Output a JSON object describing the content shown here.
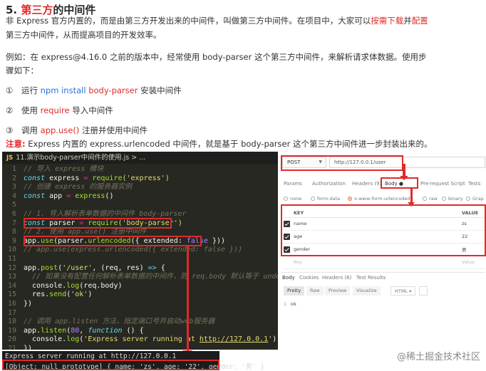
{
  "heading": {
    "number": "5.",
    "title_red": "第三方",
    "title_rest": "的中间件"
  },
  "intro": {
    "line1_a": "非 Express 官方内置的，而是由第三方开发出来的中间件，叫做第三方中间件。在项目中，大家可以",
    "line1_red1": "按需下载",
    "line1_b": "并",
    "line1_red2": "配置",
    "line2": "第三方中间件，从而提高项目的开发效率。"
  },
  "example": {
    "line1": "例如：在 express@4.16.0 之前的版本中，经常使用 body-parser 这个第三方中间件，来解析请求体数据。使用步",
    "line2": "骤如下："
  },
  "steps": [
    {
      "num": "①",
      "text_a": "运行 ",
      "code1": "npm install",
      "text_b": " ",
      "code2": "body-parser",
      "text_c": " 安装中间件"
    },
    {
      "num": "②",
      "text_a": "使用 ",
      "code1": "require",
      "text_b": " 导入中间件"
    },
    {
      "num": "③",
      "text_a": "调用 ",
      "code1": "app.use()",
      "text_b": " 注册并使用中间件"
    }
  ],
  "note": {
    "label": "注意:",
    "text": " Express 内置的 express.urlencoded 中间件，就是基于 body-parser 这个第三方中间件进一步封装出来的。"
  },
  "editor": {
    "file_icon": "JS",
    "breadcrumb": "11.演示body-parser中间件的使用.js > ...",
    "lines": {
      "n1": "1",
      "l1": "// 导入 express 模块",
      "n2": "2",
      "l2_kw": "const",
      "l2_var": " express ",
      "l2_op": "=",
      "l2_fn": " require",
      "l2_str": "('express')",
      "n3": "3",
      "l3": "// 创建 express 的服务器实例",
      "n4": "4",
      "l4_kw": "const",
      "l4_var": " app ",
      "l4_op": "=",
      "l4_fn": " express",
      "l4_rest": "()",
      "n5": "5",
      "n6": "6",
      "l6": "// 1. 导入解析表单数据的中间件 body-parser",
      "n7": "7",
      "l7_kw": "const",
      "l7_var": " parser ",
      "l7_op": "=",
      "l7_fn": " require",
      "l7_str": "('body-parser')",
      "n8": "8",
      "l8": "// 2. 使用 app.use() 注册中间件",
      "n9": "9",
      "l9_a": "app.",
      "l9_fn": "use",
      "l9_b": "(parser.",
      "l9_fn2": "urlencoded",
      "l9_c": "({ ",
      "l9_key": "extended:",
      "l9_val": " false",
      "l9_d": " }))",
      "n10": "10",
      "l10": "// app.use(express.urlencoded({ extended: false }))",
      "n11": "11",
      "n12": "12",
      "l12_a": "app.",
      "l12_fn": "post",
      "l12_b": "(",
      "l12_str": "'/user'",
      "l12_c": ", (req, res) ",
      "l12_op": "=>",
      "l12_d": " {",
      "n13": "13",
      "l13": "  // 如果没有配置任何解析表单数据的中间件，则 req.body 默认等于 undefined",
      "n14": "14",
      "l14_a": "  console.",
      "l14_fn": "log",
      "l14_b": "(req.body)",
      "n15": "15",
      "l15_a": "  res.",
      "l15_fn": "send",
      "l15_b": "(",
      "l15_str": "'ok'",
      "l15_c": ")",
      "n16": "16",
      "l16": "})",
      "n17": "17",
      "n18": "18",
      "l18": "// 调用 app.listen 方法，指定端口号并启动web服务器",
      "n19": "19",
      "l19_a": "app.",
      "l19_fn": "listen",
      "l19_b": "(",
      "l19_num": "80",
      "l19_c": ", ",
      "l19_kw": "function",
      "l19_d": " () {",
      "n20": "20",
      "l20_a": "  console.",
      "l20_fn": "log",
      "l20_b": "(",
      "l20_str": "'Express server running at ",
      "l20_url": "http://127.0.0.1",
      "l20_str2": "'",
      "l20_c": ")",
      "n21": "21",
      "l21": "})"
    }
  },
  "terminal": {
    "line1": "Express server running at http://127.0.0.1",
    "line2": "[Object: null prototype] { name: 'zs', age: '22', gender: '男' }"
  },
  "postman": {
    "method": "POST",
    "url": "http://127.0.0.1/user",
    "tabs": [
      "Params",
      "Authorization",
      "Headers (9)",
      "Body ●",
      "Pre-request Script",
      "Tests"
    ],
    "active_tab": "Body ●",
    "body_modes": [
      "none",
      "form-data",
      "x-www-form-urlencoded",
      "raw",
      "binary",
      "Grap"
    ],
    "active_mode": "x-www-form-urlencoded",
    "table_headers": {
      "key": "KEY",
      "value": "VALUE"
    },
    "rows": [
      {
        "key": "name",
        "value": "zs"
      },
      {
        "key": "age",
        "value": "22"
      },
      {
        "key": "gender",
        "value": "男"
      }
    ],
    "placeholder_row": {
      "key": "Key",
      "value": "Value"
    },
    "response_tabs": [
      "Body",
      "Cookies",
      "Headers (6)",
      "Test Results"
    ],
    "view_tabs": [
      "Pretty",
      "Raw",
      "Preview",
      "Visualize"
    ],
    "format": "HTML ▾",
    "response_line_no": "1",
    "response_text": "ok"
  },
  "watermark": "@稀土掘金技术社区"
}
